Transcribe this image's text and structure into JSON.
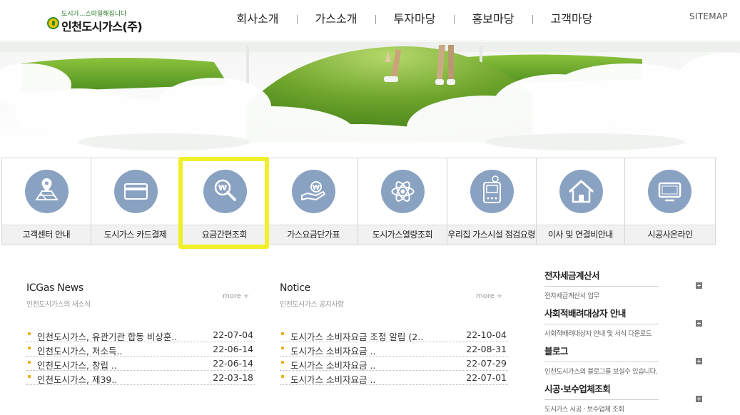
{
  "header": {
    "logo_tagline": "도시가...스마일해집니다",
    "logo_name": "인천도시가스(주)",
    "nav": [
      "회사소개",
      "가스소개",
      "투자마당",
      "홍보마당",
      "고객마당"
    ],
    "sitemap": "SITEMAP"
  },
  "quick_menu": [
    {
      "label": "고객센터 안내",
      "icon": "map-pin-icon"
    },
    {
      "label": "도시가스 카드결제",
      "icon": "credit-card-icon"
    },
    {
      "label": "요금간편조회",
      "icon": "won-search-icon"
    },
    {
      "label": "가스요금단가표",
      "icon": "hand-coin-icon"
    },
    {
      "label": "도시가스열량조회",
      "icon": "atom-icon"
    },
    {
      "label": "우리집 가스시설 점검요령",
      "icon": "gas-meter-icon"
    },
    {
      "label": "이사 및 연결비안내",
      "icon": "house-icon"
    },
    {
      "label": "시공사온라인",
      "icon": "monitor-icon"
    }
  ],
  "highlight_color": "#f0f02a",
  "news": {
    "title": "ICGas News",
    "subtitle": "인천도시가스의 새소식",
    "more": "more",
    "items": [
      {
        "title": "인천도시가스, 유관기관 합동 비상훈..",
        "date": "22-07-04"
      },
      {
        "title": "인천도시가스, 저소득..",
        "date": "22-06-14"
      },
      {
        "title": "인천도시가스, 창립 ..",
        "date": "22-06-14"
      },
      {
        "title": "인천도시가스, 제39..",
        "date": "22-03-18"
      }
    ]
  },
  "notice": {
    "title": "Notice",
    "subtitle": "인천도시가스 공지사항",
    "more": "more",
    "items": [
      {
        "title": "도시가스 소비자요금 조정 알림 (2..",
        "date": "22-10-04"
      },
      {
        "title": "도시가스 소비자요금 ..",
        "date": "22-08-31"
      },
      {
        "title": "도시가스 소비자요금 ..",
        "date": "22-07-29"
      },
      {
        "title": "도시가스 소비자요금 ..",
        "date": "22-07-01"
      }
    ]
  },
  "side_links": [
    {
      "title": "전자세금계산서",
      "desc": "전자세금계산서 업무"
    },
    {
      "title": "사회적배려대상자 안내",
      "desc": "사회적배려대상자 안내 및 서식 다운로드"
    },
    {
      "title": "블로그",
      "desc": "인천도시가스의 블로그를 보실수 있습니다."
    },
    {
      "title": "시공·보수업체조회",
      "desc": "도시가스 시공 · 보수업체 조회"
    }
  ]
}
